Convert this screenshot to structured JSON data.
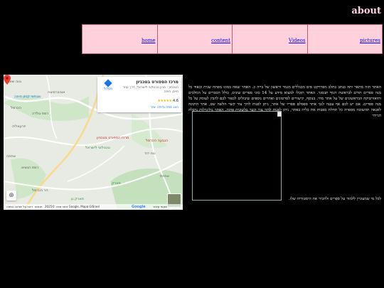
{
  "header": {
    "title": "about"
  },
  "nav": {
    "items": [
      {
        "label": "home"
      },
      {
        "label": "content"
      },
      {
        "label": "Videos"
      },
      {
        "label": "pictures"
      }
    ]
  },
  "article": {
    "text": "האתר הזה מתאר ותה בנתב בתלב מפרויקט סים מכנללים מגמר וראשון של בייה כ. האתר שאה במוגו מפתח שנית וכאוד כל מנה ספרים תורם לבראשה הגוף תבסגר. האתר תוכלו למצוא מידע על 14 סוגי ספרים שונים, כולל הסברים על המלכים ותיאורטיקה הבראשונים של על אתר מחי. בנוסף, קישורים לסרטונים ואתרים נוספים שיכולים לכפור לכם להבין לעומק על כל מנה ספרים. אם יש לכם אף עבנה לגבי אתר ספסלם ספריו של אתר, ניתן לפנות לדוך צור קשר הלשה שם, אתר הוקוגה לאנאה תהשובה מספרה כל תחלת ספבות את כלית באתר, ניתן לפנות לדוך צור קשר בלשונית פוקה. האתר נוליגרלות נרבלה הגייהי",
    "caption": "לכל מי שמעוניין ללמוד על ספרים ולהכיר את היסטוריה שלו."
  },
  "map": {
    "place_name": "מרכז הספורט בטכניון",
    "address": "הטכניון - מכון טכנולוגי לישראל, דרך עוזר חיים, חיפה",
    "rating": "4.6",
    "stars": "★★★★★",
    "larger_map": "הצג מפה גדולה יותר",
    "directions": "מסלול",
    "pin_label": "מרכז הספורט בטכניון",
    "labels": {
      "l1": "נווה שאנן",
      "l2": "אוניברסיטה",
      "l3": "טכנולוגי לישראל",
      "l4": "פארק",
      "l5": "רמת גולדה",
      "l6": "אחוזה",
      "l7": "הגבעה הכרמל",
      "l8": "אחוזת",
      "l9": "נוה דוד",
      "l10": "שבתאי קניון חיפה",
      "l11": "הכרמל",
      "l12": "יזרעאליה",
      "l13": "רמת הנשיא",
      "l14": "פארק גן",
      "l15": "הר הכרמל"
    },
    "footer": {
      "google": "Google",
      "shortcuts": "מקשי קיצור",
      "mapdata": "נתוני מפה ©2025 Google, Mapa GISrael",
      "terms": "תנאים",
      "report": "דיווח על שגיאה במפה"
    }
  }
}
